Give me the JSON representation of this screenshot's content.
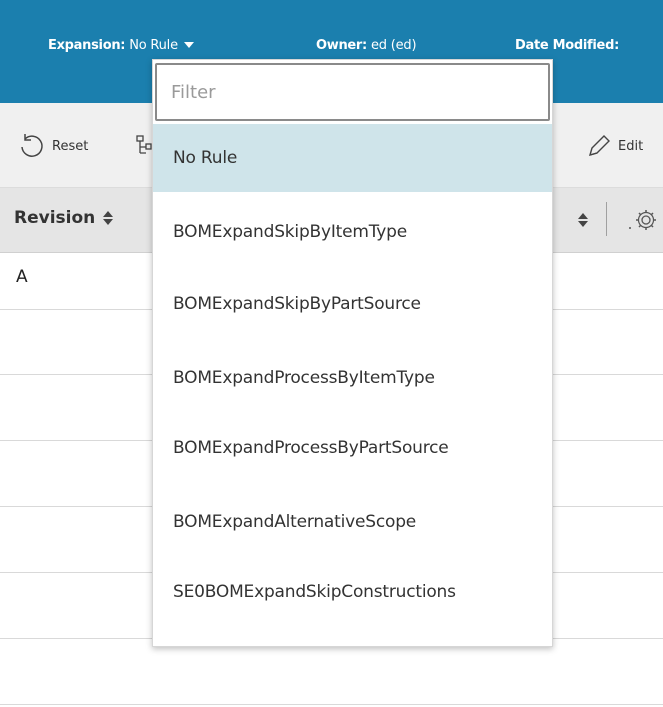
{
  "header": {
    "expansion_label": "Expansion:",
    "expansion_value": "No Rule",
    "owner_label": "Owner:",
    "owner_value": "ed (ed)",
    "date_label": "Date Modified:"
  },
  "toolbar": {
    "reset_label": "Reset",
    "edit_label": "Edit"
  },
  "table": {
    "columns": [
      "Revision"
    ],
    "rows": [
      {
        "revision": "A"
      }
    ]
  },
  "dropdown": {
    "filter_placeholder": "Filter",
    "filter_value": "",
    "options": [
      "No Rule",
      "BOMExpandSkipByItemType",
      "BOMExpandSkipByPartSource",
      "BOMExpandProcessByItemType",
      "BOMExpandProcessByPartSource",
      "BOMExpandAlternativeScope",
      "SE0BOMExpandSkipConstructions"
    ],
    "selected": "No Rule"
  },
  "colors": {
    "header_bg": "#1b7fae",
    "selected_option_bg": "#cfe4ea",
    "toolbar_bg": "#f0f0f0",
    "table_header_bg": "#e5e5e5"
  },
  "icons": [
    "reset-icon",
    "structure-icon",
    "edit-icon",
    "sort-icon",
    "settings-icon",
    "caret-down-icon"
  ]
}
